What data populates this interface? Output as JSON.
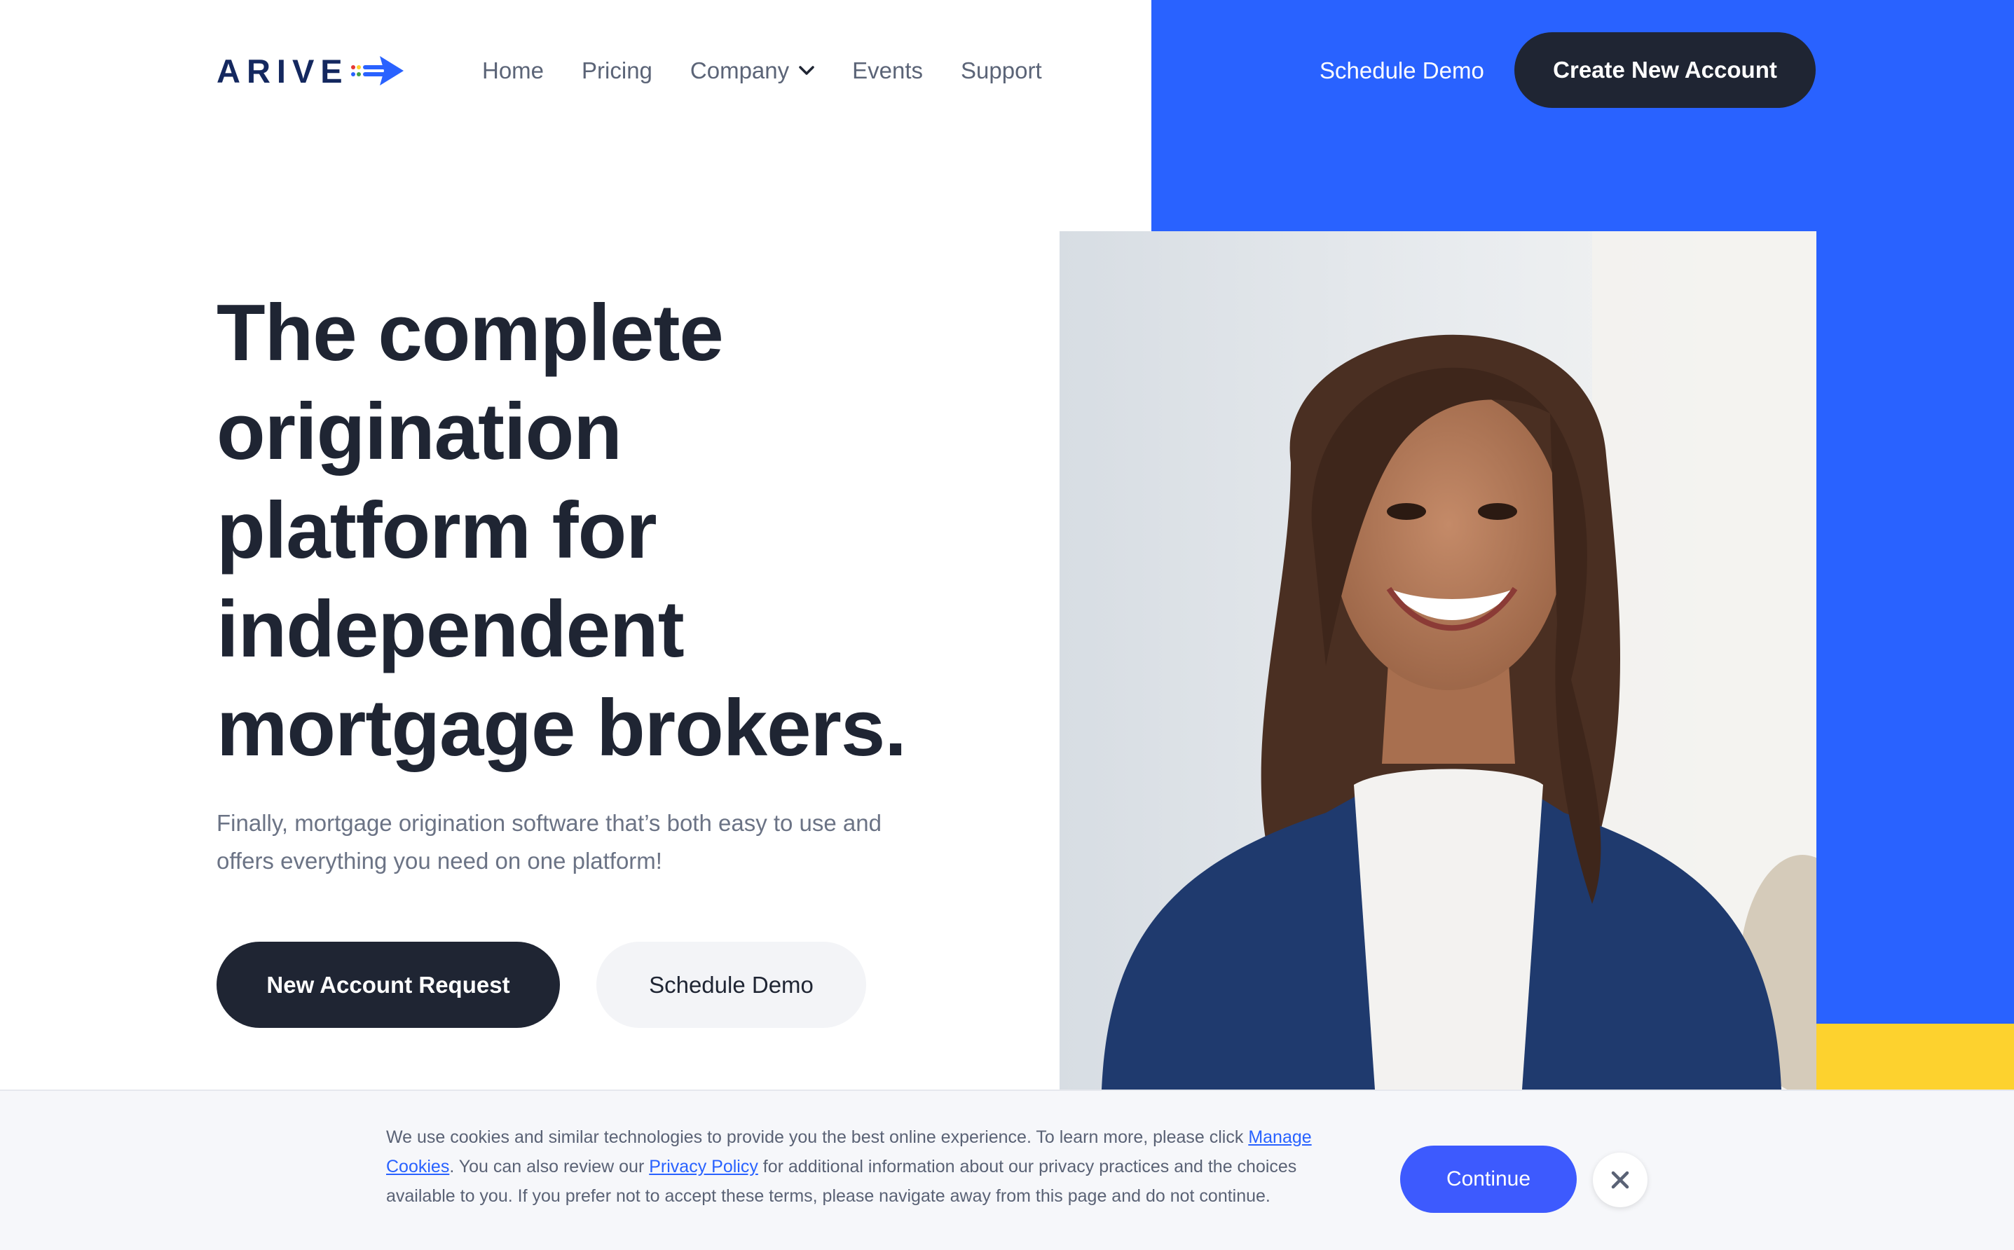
{
  "brand": {
    "name": "ARIVE",
    "accent": "#2962ff",
    "yellow": "#fdd22e",
    "dark": "#1f2533"
  },
  "nav": {
    "items": [
      {
        "label": "Home"
      },
      {
        "label": "Pricing"
      },
      {
        "label": "Company",
        "has_dropdown": true,
        "icon": "chevron-down-icon"
      },
      {
        "label": "Events"
      },
      {
        "label": "Support"
      }
    ]
  },
  "header": {
    "schedule_demo": "Schedule Demo",
    "create_account": "Create New Account"
  },
  "hero": {
    "title_lines": [
      "The complete",
      "origination",
      "platform for",
      "independent",
      "mortgage brokers."
    ],
    "subtitle_lines": [
      "Finally, mortgage origination software that’s both easy to use and",
      "offers everything you need on one platform!"
    ],
    "primary_cta": "New Account Request",
    "secondary_cta": "Schedule Demo"
  },
  "cookie": {
    "text_1": "We use cookies and similar technologies to provide you the best online experience. To learn more, please click ",
    "link_manage": "Manage Cookies",
    "text_2": ". You can also review our ",
    "link_privacy": "Privacy Policy",
    "text_3": " for additional information about our privacy practices and the choices available to you. If you prefer not to accept these terms, please navigate away from this page and do not continue.",
    "continue": "Continue",
    "close_icon": "close-icon"
  }
}
